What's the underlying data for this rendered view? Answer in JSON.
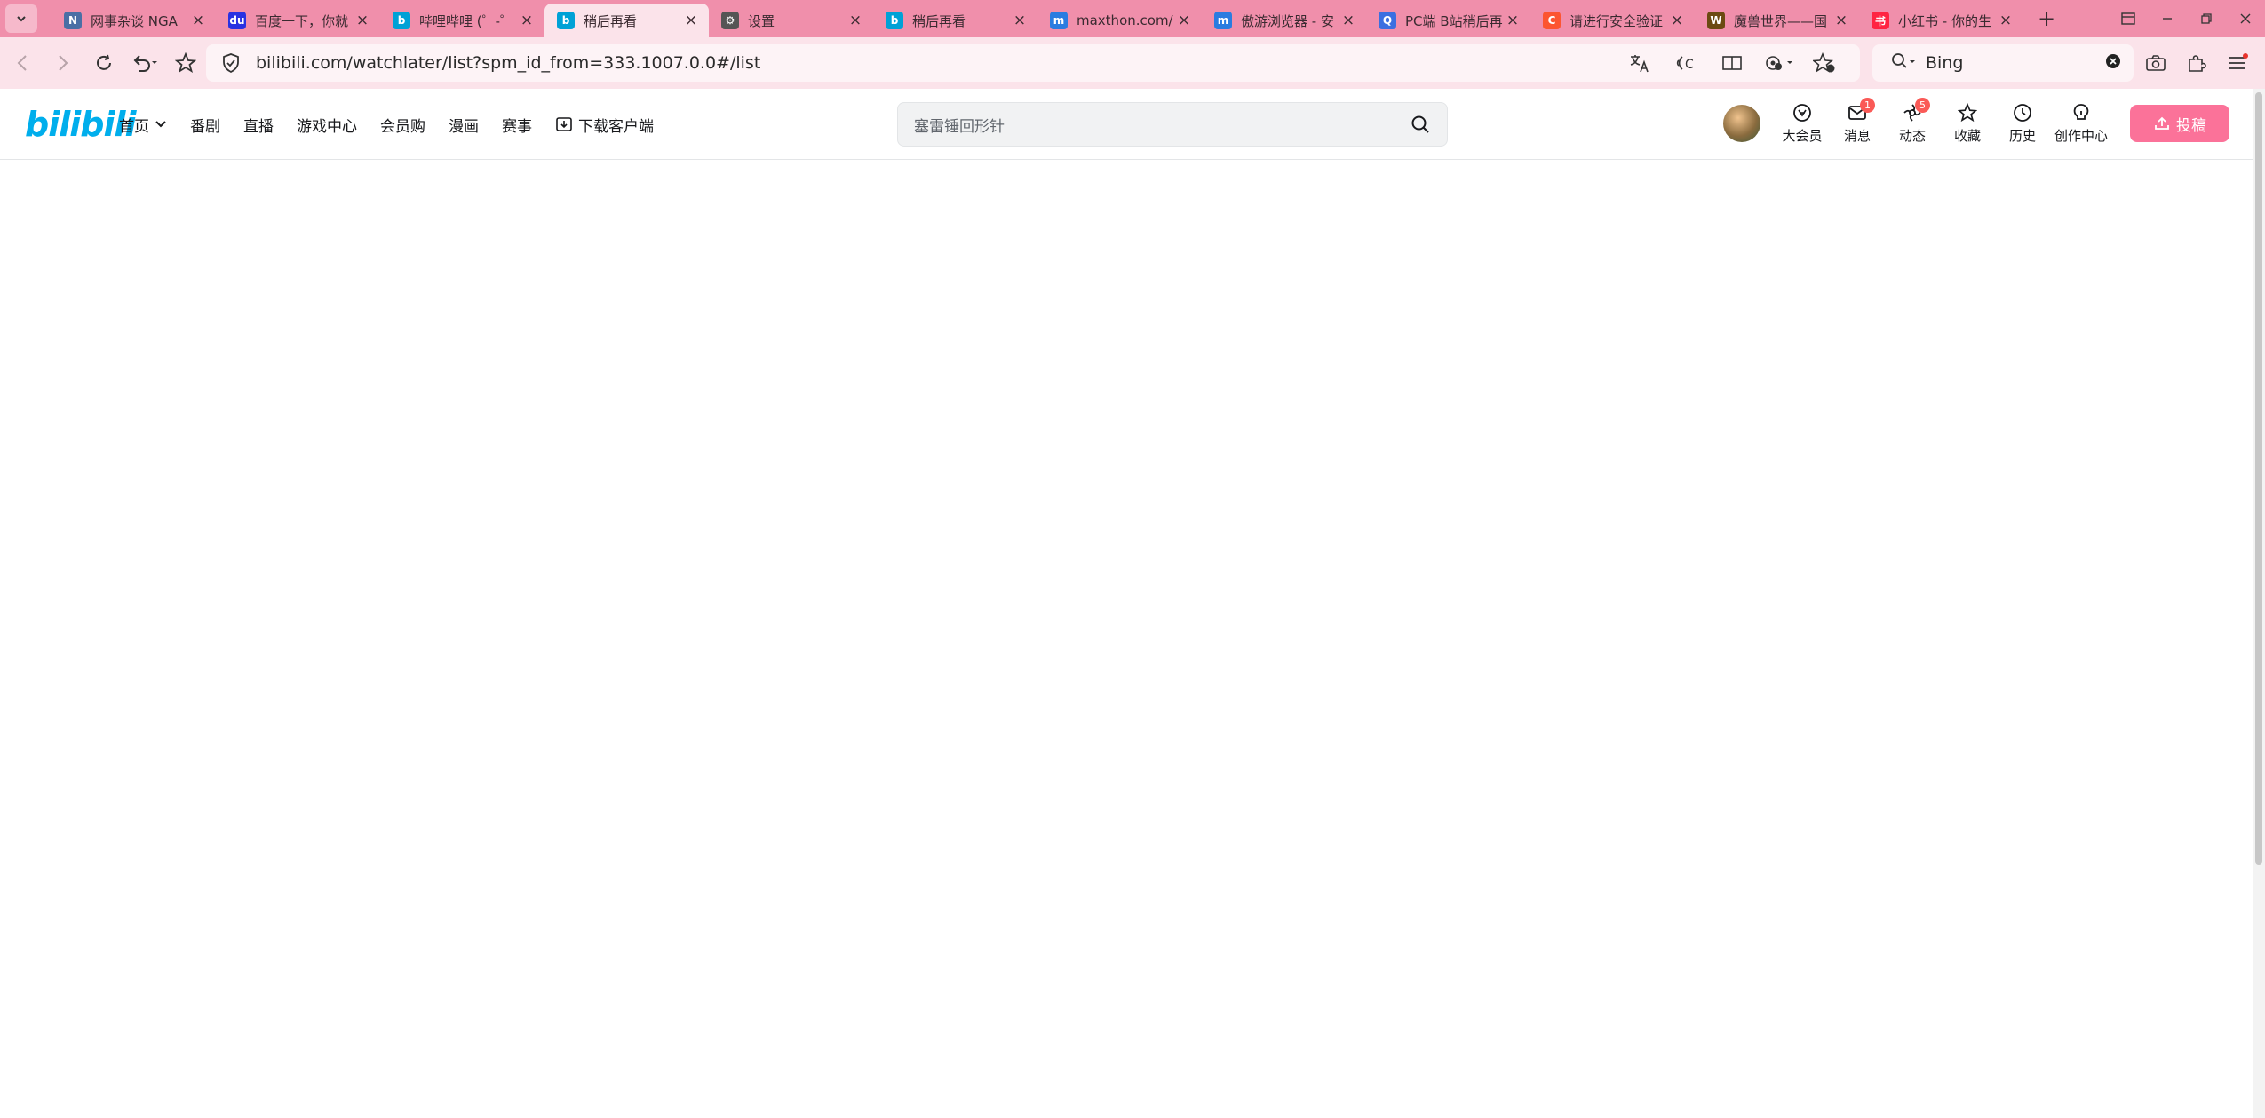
{
  "browser": {
    "tabs": [
      {
        "title": "网事杂谈 NGA",
        "icon": "nga-icon",
        "color": "#4a6fa5",
        "active": false
      },
      {
        "title": "百度一下，你就",
        "icon": "baidu-icon",
        "color": "#2932e1",
        "active": false
      },
      {
        "title": "哔哩哔哩 (゜-゜",
        "icon": "bilibili-icon",
        "color": "#00a1d6",
        "active": false
      },
      {
        "title": "稍后再看",
        "icon": "bilibili-icon",
        "color": "#00a1d6",
        "active": true
      },
      {
        "title": "设置",
        "icon": "gear-icon",
        "color": "#555555",
        "active": false
      },
      {
        "title": "稍后再看",
        "icon": "bilibili-icon",
        "color": "#00a1d6",
        "active": false
      },
      {
        "title": "maxthon.com/",
        "icon": "maxthon-icon",
        "color": "#2a7ce0",
        "active": false
      },
      {
        "title": "傲游浏览器 - 安",
        "icon": "maxthon-icon",
        "color": "#2a7ce0",
        "active": false
      },
      {
        "title": "PC端 B站稍后再",
        "icon": "search-icon",
        "color": "#3b6fe0",
        "active": false
      },
      {
        "title": "请进行安全验证",
        "icon": "csdn-icon",
        "color": "#fc5531",
        "active": false
      },
      {
        "title": "魔兽世界——国",
        "icon": "wow-icon",
        "color": "#6b4a12",
        "active": false
      },
      {
        "title": "小红书 - 你的生",
        "icon": "xiaohongshu-icon",
        "color": "#ff2442",
        "active": false
      }
    ],
    "url": "bilibili.com/watchlater/list?spm_id_from=333.1007.0.0#/list",
    "search_engine": "Bing"
  },
  "bili": {
    "logo": "bilibili",
    "nav": [
      "首页",
      "番剧",
      "直播",
      "游戏中心",
      "会员购",
      "漫画",
      "赛事",
      "下载客户端"
    ],
    "search_placeholder": "塞雷锤回形针",
    "right_nav": [
      {
        "label": "大会员",
        "icon": "vip-icon",
        "badge": ""
      },
      {
        "label": "消息",
        "icon": "message-icon",
        "badge": "1"
      },
      {
        "label": "动态",
        "icon": "dynamic-icon",
        "badge": "5"
      },
      {
        "label": "收藏",
        "icon": "star-icon",
        "badge": ""
      },
      {
        "label": "历史",
        "icon": "history-icon",
        "badge": ""
      },
      {
        "label": "创作中心",
        "icon": "bulb-icon",
        "badge": ""
      }
    ],
    "upload_label": "投稿",
    "accent": "#fb7299",
    "brand": "#00aeec"
  }
}
